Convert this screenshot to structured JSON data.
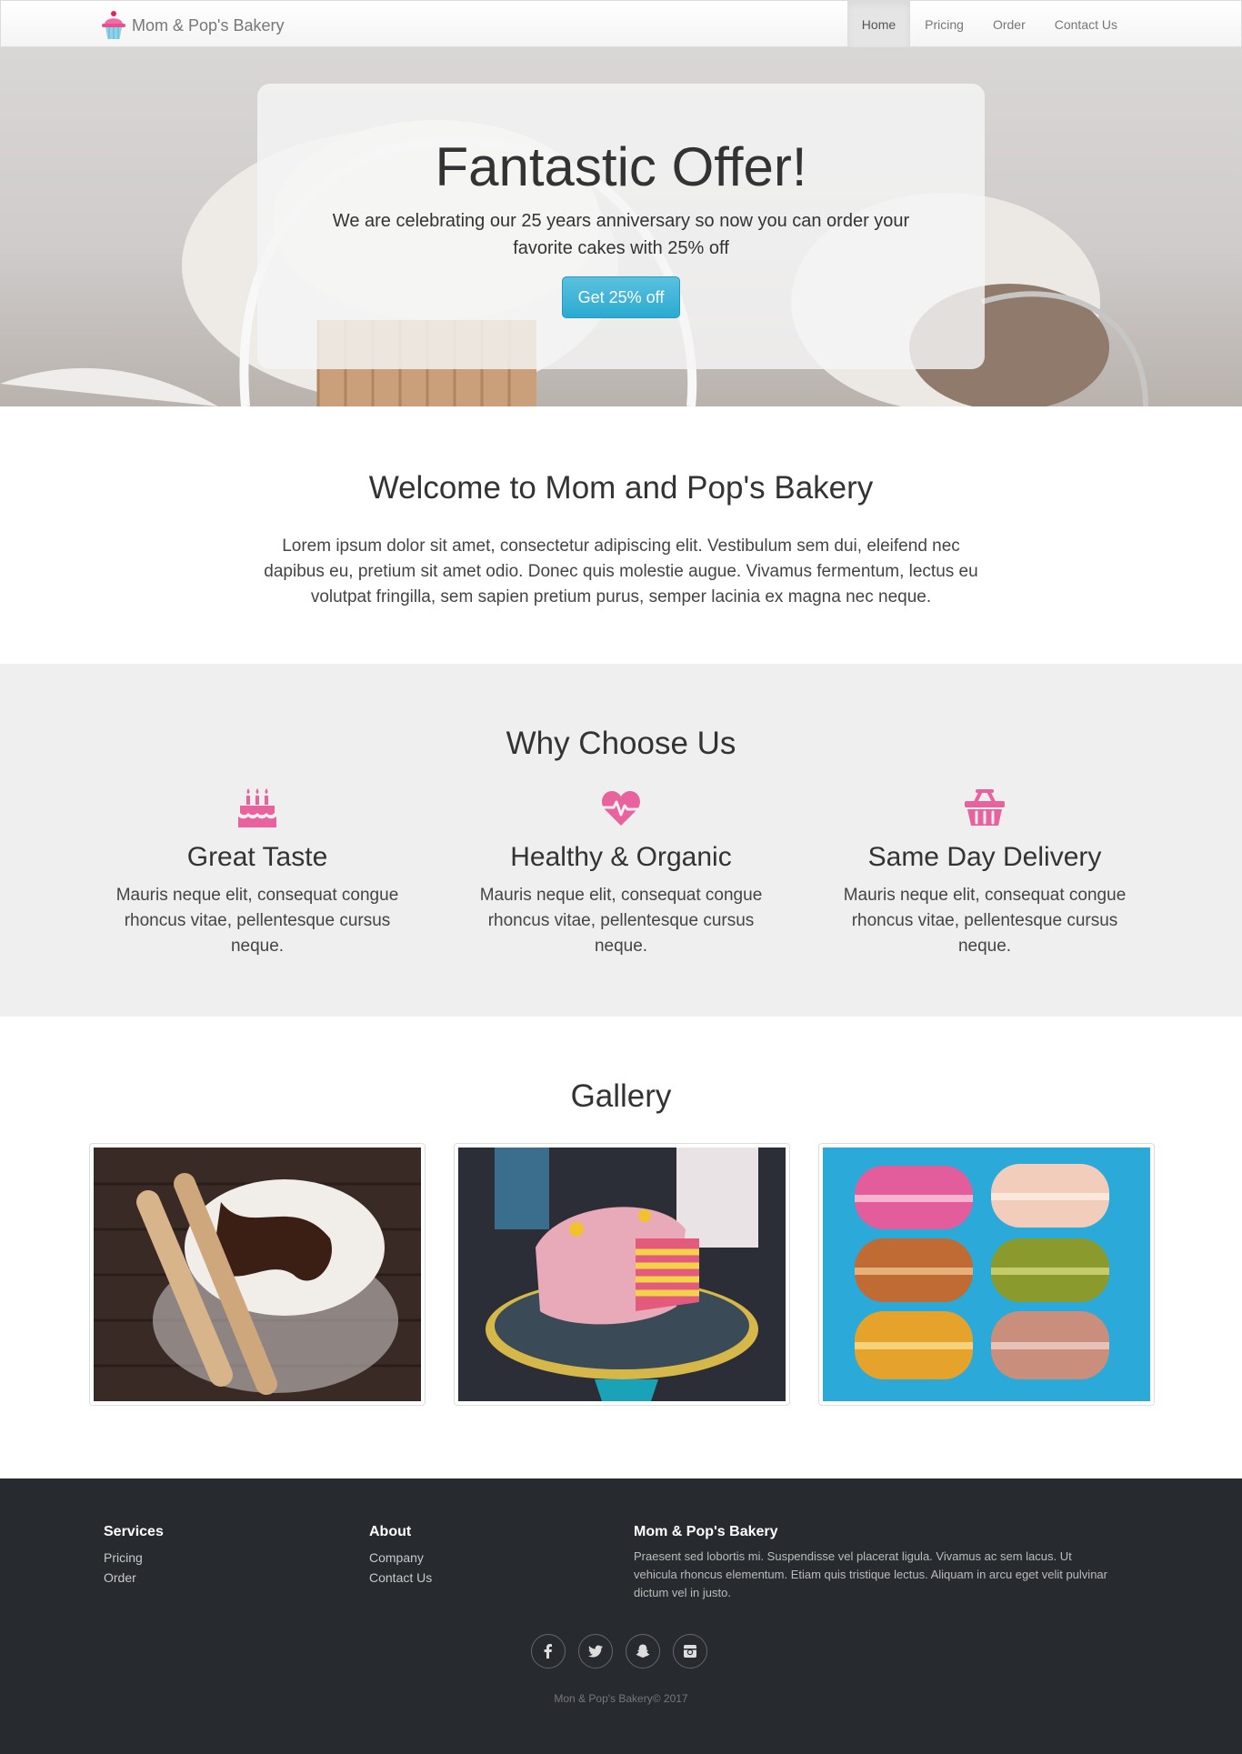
{
  "navbar": {
    "brand": "Mom & Pop's Bakery",
    "items": [
      {
        "label": "Home",
        "active": true
      },
      {
        "label": "Pricing"
      },
      {
        "label": "Order"
      },
      {
        "label": "Contact Us"
      }
    ]
  },
  "hero": {
    "title": "Fantastic Offer!",
    "text": "We are celebrating our 25 years anniversary so now you can order your favorite cakes with 25% off",
    "button": "Get 25% off"
  },
  "welcome": {
    "title": "Welcome to Mom and Pop's Bakery",
    "text": "Lorem ipsum dolor sit amet, consectetur adipiscing elit. Vestibulum sem dui, eleifend nec dapibus eu, pretium sit amet odio. Donec quis molestie augue. Vivamus fermentum, lectus eu volutpat fringilla, sem sapien pretium purus, semper lacinia ex magna nec neque."
  },
  "why": {
    "title": "Why Choose Us",
    "accent_color": "#e8629e",
    "features": [
      {
        "icon": "birthday-cake-icon",
        "title": "Great Taste",
        "text": "Mauris neque elit, consequat congue rhoncus vitae, pellentesque cursus neque."
      },
      {
        "icon": "heartbeat-icon",
        "title": "Healthy & Organic",
        "text": "Mauris neque elit, consequat congue rhoncus vitae, pellentesque cursus neque."
      },
      {
        "icon": "shopping-basket-icon",
        "title": "Same Day Delivery",
        "text": "Mauris neque elit, consequat congue rhoncus vitae, pellentesque cursus neque."
      }
    ]
  },
  "gallery": {
    "title": "Gallery",
    "images": [
      "ice-cream-sundae-photo",
      "sprinkle-layer-cake-photo",
      "macarons-photo"
    ]
  },
  "footer": {
    "services": {
      "title": "Services",
      "links": [
        "Pricing",
        "Order"
      ]
    },
    "about": {
      "title": "About",
      "links": [
        "Company",
        "Contact Us"
      ]
    },
    "bakery": {
      "title": "Mom & Pop's Bakery",
      "text": "Praesent sed lobortis mi. Suspendisse vel placerat ligula. Vivamus ac sem lacus. Ut vehicula rhoncus elementum. Etiam quis tristique lectus. Aliquam in arcu eget velit pulvinar dictum vel in justo."
    },
    "social": [
      "facebook-icon",
      "twitter-icon",
      "snapchat-icon",
      "instagram-icon"
    ],
    "copyright": "Mon & Pop's Bakery© 2017"
  }
}
